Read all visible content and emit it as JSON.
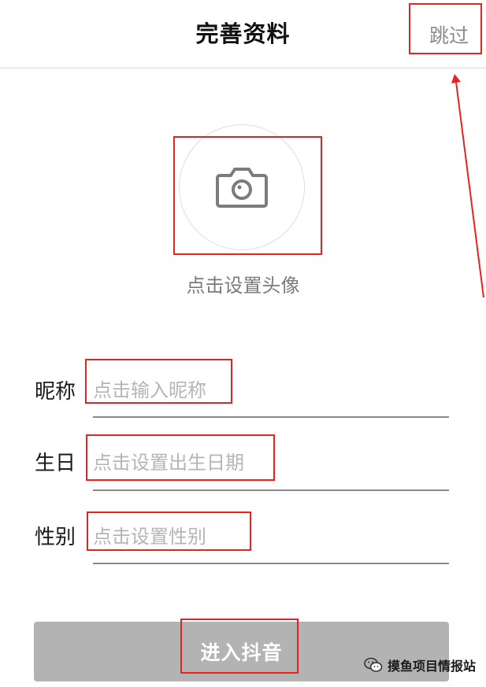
{
  "header": {
    "title": "完善资料",
    "skip_label": "跳过"
  },
  "avatar": {
    "caption": "点击设置头像"
  },
  "form": {
    "nickname": {
      "label": "昵称",
      "placeholder": "点击输入昵称"
    },
    "birthday": {
      "label": "生日",
      "placeholder": "点击设置出生日期"
    },
    "gender": {
      "label": "性别",
      "placeholder": "点击设置性别"
    }
  },
  "submit": {
    "label": "进入抖音"
  },
  "watermark": {
    "text": "摸鱼项目情报站"
  },
  "colors": {
    "annotation": "#e8231f",
    "submit_bg": "#b3b3b3",
    "placeholder": "#b5b5b5"
  }
}
